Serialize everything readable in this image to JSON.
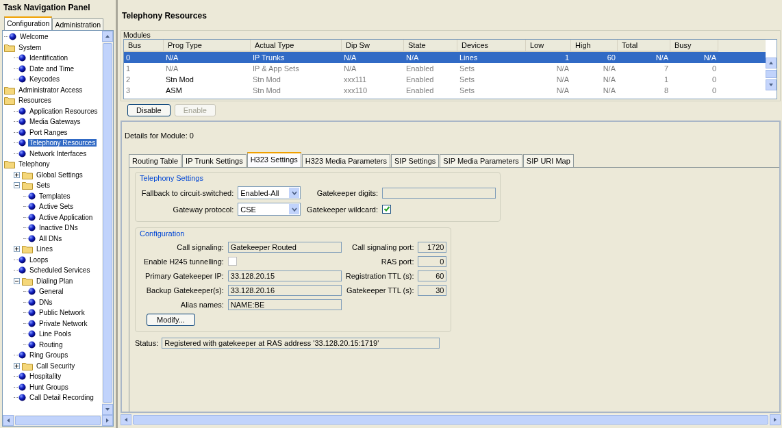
{
  "nav": {
    "title": "Task Navigation Panel",
    "tabs": [
      {
        "label": "Configuration",
        "selected": true
      },
      {
        "label": "Administration",
        "selected": false
      }
    ],
    "tree": [
      {
        "label": "Welcome",
        "kind": "leaf",
        "selected": false
      },
      {
        "label": "System",
        "kind": "folder",
        "children": [
          {
            "label": "Identification",
            "kind": "leaf",
            "selected": false
          },
          {
            "label": "Date and Time",
            "kind": "leaf",
            "selected": false
          },
          {
            "label": "Keycodes",
            "kind": "leaf",
            "selected": false
          }
        ]
      },
      {
        "label": "Administrator Access",
        "kind": "folder"
      },
      {
        "label": "Resources",
        "kind": "folder",
        "children": [
          {
            "label": "Application Resources",
            "kind": "leaf",
            "selected": false
          },
          {
            "label": "Media Gateways",
            "kind": "leaf",
            "selected": false
          },
          {
            "label": "Port Ranges",
            "kind": "leaf",
            "selected": false
          },
          {
            "label": "Telephony Resources",
            "kind": "leaf",
            "selected": true
          },
          {
            "label": "Network Interfaces",
            "kind": "leaf",
            "selected": false
          }
        ]
      },
      {
        "label": "Telephony",
        "kind": "folder",
        "children": [
          {
            "label": "Global Settings",
            "kind": "folder",
            "expanded": false
          },
          {
            "label": "Sets",
            "kind": "folder",
            "expanded": true,
            "children": [
              {
                "label": "Templates",
                "kind": "leaf",
                "selected": false
              },
              {
                "label": "Active Sets",
                "kind": "leaf",
                "selected": false
              },
              {
                "label": "Active Application",
                "kind": "leaf",
                "selected": false
              },
              {
                "label": "Inactive DNs",
                "kind": "leaf",
                "selected": false
              },
              {
                "label": "All DNs",
                "kind": "leaf",
                "selected": false
              }
            ]
          },
          {
            "label": "Lines",
            "kind": "folder",
            "expanded": false
          },
          {
            "label": "Loops",
            "kind": "leaf",
            "selected": false
          },
          {
            "label": "Scheduled Services",
            "kind": "leaf",
            "selected": false
          },
          {
            "label": "Dialing Plan",
            "kind": "folder",
            "expanded": true,
            "children": [
              {
                "label": "General",
                "kind": "leaf",
                "selected": false
              },
              {
                "label": "DNs",
                "kind": "leaf",
                "selected": false
              },
              {
                "label": "Public Network",
                "kind": "leaf",
                "selected": false
              },
              {
                "label": "Private Network",
                "kind": "leaf",
                "selected": false
              },
              {
                "label": "Line Pools",
                "kind": "leaf",
                "selected": false
              },
              {
                "label": "Routing",
                "kind": "leaf",
                "selected": false
              }
            ]
          },
          {
            "label": "Ring Groups",
            "kind": "leaf",
            "selected": false
          },
          {
            "label": "Call Security",
            "kind": "folder",
            "expanded": false
          },
          {
            "label": "Hospitality",
            "kind": "leaf",
            "selected": false
          },
          {
            "label": "Hunt Groups",
            "kind": "leaf",
            "selected": false
          },
          {
            "label": "Call Detail Recording",
            "kind": "leaf",
            "selected": false
          }
        ]
      }
    ]
  },
  "title": "Telephony Resources",
  "modules": {
    "title": "Modules",
    "columns": [
      "Bus",
      "Prog Type",
      "Actual Type",
      "Dip Sw",
      "State",
      "Devices",
      "Low",
      "High",
      "Total",
      "Busy"
    ],
    "rows": [
      {
        "selected": true,
        "prog_type_editable": false,
        "cells": [
          "0",
          "N/A",
          "IP Trunks",
          "N/A",
          "N/A",
          "Lines",
          "1",
          "60",
          "N/A",
          "N/A"
        ]
      },
      {
        "selected": false,
        "prog_type_editable": false,
        "cells": [
          "1",
          "N/A",
          "IP & App Sets",
          "N/A",
          "Enabled",
          "Sets",
          "N/A",
          "N/A",
          "7",
          "0"
        ]
      },
      {
        "selected": false,
        "prog_type_editable": true,
        "cells": [
          "2",
          "Stn Mod",
          "Stn Mod",
          "xxx111",
          "Enabled",
          "Sets",
          "N/A",
          "N/A",
          "1",
          "0"
        ]
      },
      {
        "selected": false,
        "prog_type_editable": true,
        "cells": [
          "3",
          "ASM",
          "Stn Mod",
          "xxx110",
          "Enabled",
          "Sets",
          "N/A",
          "N/A",
          "8",
          "0"
        ]
      }
    ],
    "buttons": [
      {
        "label": "Disable",
        "disabled": false
      },
      {
        "label": "Enable",
        "disabled": true
      }
    ]
  },
  "details": {
    "heading": "Details for Module: 0",
    "tabs": [
      {
        "label": "Routing Table",
        "selected": false
      },
      {
        "label": "IP Trunk Settings",
        "selected": false
      },
      {
        "label": "H323 Settings",
        "selected": true
      },
      {
        "label": "H323 Media Parameters",
        "selected": false
      },
      {
        "label": "SIP Settings",
        "selected": false
      },
      {
        "label": "SIP Media Parameters",
        "selected": false
      },
      {
        "label": "SIP URI Map",
        "selected": false
      }
    ],
    "telephony": {
      "title": "Telephony Settings",
      "fallback_label": "Fallback to circuit-switched:",
      "fallback_value": "Enabled-All",
      "protocol_label": "Gateway protocol:",
      "protocol_value": "CSE",
      "digits_label": "Gatekeeper digits:",
      "wildcard_label": "Gatekeeper wildcard:",
      "wildcard_checked": true
    },
    "configuration": {
      "title": "Configuration",
      "call_signaling_label": "Call signaling:",
      "call_signaling": "Gatekeeper Routed",
      "h245_label": "Enable H245 tunnelling:",
      "h245_checked": false,
      "primary_label": "Primary Gatekeeper IP:",
      "primary": "33.128.20.15",
      "backup_label": "Backup Gatekeeper(s):",
      "backup": "33.128.20.16",
      "alias_label": "Alias names:",
      "alias": "NAME:BE",
      "port_label": "Call signaling port:",
      "port": "1720",
      "ras_label": "RAS port:",
      "ras": "0",
      "reg_ttl_label": "Registration TTL (s):",
      "reg_ttl": "60",
      "gk_ttl_label": "Gatekeeper TTL (s):",
      "gk_ttl": "30",
      "modify_button": "Modify..."
    },
    "status_label": "Status:",
    "status": "Registered with gatekeeper at RAS address '33.128.20.15:1719'"
  }
}
